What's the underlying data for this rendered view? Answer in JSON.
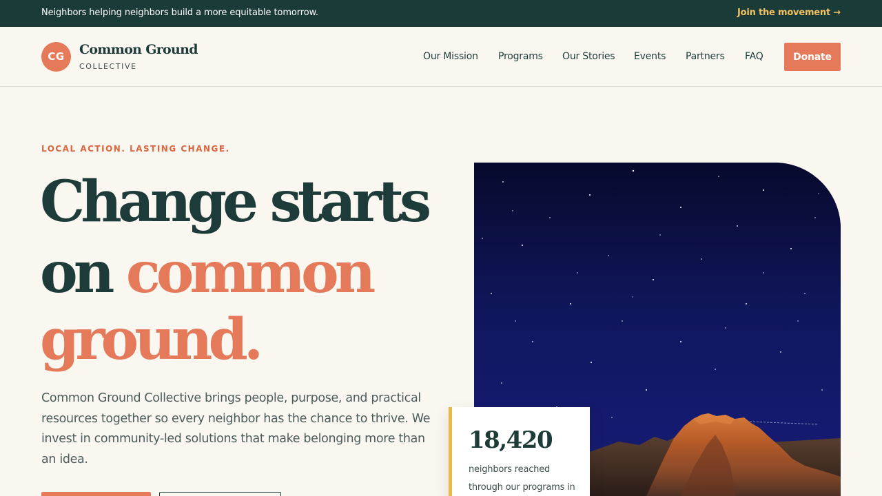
{
  "topbar": {
    "message": "Neighbors helping neighbors build a more equitable tomorrow.",
    "link_label": "Join the movement →"
  },
  "header": {
    "logo_initials": "CG",
    "logo_name": "Common Ground",
    "logo_sub": "COLLECTIVE",
    "nav": [
      "Our Mission",
      "Programs",
      "Our Stories",
      "Events",
      "Partners",
      "FAQ"
    ],
    "donate_label": "Donate"
  },
  "hero": {
    "eyebrow": "LOCAL ACTION. LASTING CHANGE.",
    "headline_line1": "Change starts",
    "headline_line2_a": "on ",
    "headline_line2_b": "common",
    "headline_line3": "ground.",
    "description": "Common Ground Collective brings people, purpose, and practical resources together so every neighbor has the chance to thrive. We invest in community-led solutions that make belonging more than an idea."
  },
  "stat": {
    "number": "18,420",
    "label": "neighbors reached through our programs in"
  },
  "colors": {
    "primary": "#1b3b38",
    "accent": "#e47a59",
    "highlight": "#e8b94a",
    "link": "#f2c262",
    "background": "#faf6f0"
  },
  "icons": {
    "arrow": "right-arrow-icon"
  }
}
